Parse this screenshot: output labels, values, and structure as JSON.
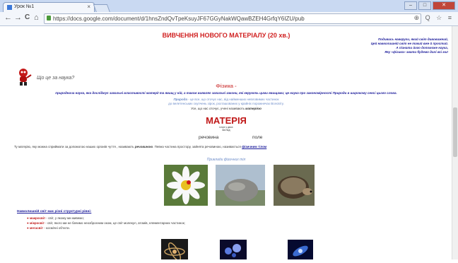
{
  "browser": {
    "tab_title": "Урок №1",
    "tab_close": "×",
    "url": "https://docs.google.com/document/d/1hnsZndQvTpeKsuyJF67GGyNakWQawBZEH4GrfqY6IZU/pub",
    "nav_back": "←",
    "nav_forward": "→",
    "nav_reload": "C",
    "nav_home": "⌂",
    "right_icons": "⊕ Q ☆ ≡",
    "win_min": "–",
    "win_max": "□",
    "win_close": "✕"
  },
  "doc": {
    "main_title": "ВИВЧЕННЯ НОВОГО МАТЕРІАЛУ (20 хв.)",
    "poem": [
      "Подивись навкруги, який світ дивовижний,",
      "Цей навколишній світ не такий вже й простий.",
      "А пізнати його допоможе наука,",
      "Яку «фізика» звати будемо далі всі ми!"
    ],
    "question": "Що це за наука?",
    "physics_heading": "Фізика -",
    "physics_definition": "природнича наука, яка досліджує загальні властивості матерії та явищ у ній, а також виявляє загальні закони, які керують цими явищами; це наука про закономірності Природи в широкому сенсі цього слова.",
    "sub1_term": "Природа",
    "sub1_rest": " - це все, що оточує нас, від найменших невловимих частинок",
    "sub2": "до велетенських скупчень зірок, розташованих у крайніх порожнечах Всесвіту.",
    "sub3_pre": "Усе, що нас оточує, учені називають ",
    "sub3_term": "матерією",
    "matter_word": "МАТЕРІЯ",
    "matter_note_line1": "існує у двох",
    "matter_note_line2": "вигляд",
    "substance": "речовина",
    "field": "поле",
    "matter_def_pre": "Ту матерію, яку можна сприймати за допомогою наших органів чуття , називають ",
    "matter_def_term1": "речовиною",
    "matter_def_mid": ". Певна частина простору, зайнята речовиною, називається ",
    "matter_def_link": "фізичним тілом",
    "examples_caption": "Приклади фізичних тіл",
    "structure_title": "Навколишній світ має різні структурні рівні:",
    "structure_items": [
      {
        "bullet": "●",
        "term": "макросвіт",
        "text": " - світ, у якому ми живемо;"
      },
      {
        "bullet": "●",
        "term": "мікросвіт",
        "text": " - світ, якого ми не бачимо неозброєним оком, це світ молекул, атомів, елементарних частинок;"
      },
      {
        "bullet": "●",
        "term": "мегасвіт",
        "text": " - космічні об'єкти."
      }
    ]
  },
  "colors": {
    "title_red": "#d02020",
    "poem_blue": "#1a1a9a",
    "light_blue": "#6a8ac8"
  },
  "icons": [
    "flower-photo-icon",
    "stone-photo-icon",
    "hedgehog-photo-icon",
    "atom-photo-icon",
    "molecule-photo-icon",
    "galaxy-photo-icon",
    "mascot-icon",
    "lock-icon"
  ]
}
